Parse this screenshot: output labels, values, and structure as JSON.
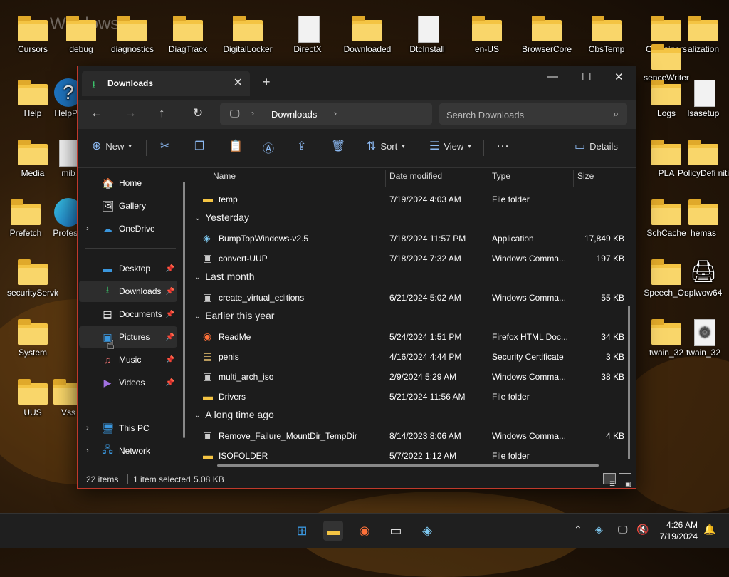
{
  "desktop": {
    "watermark": "Windows",
    "icons": [
      {
        "label": "Cursors",
        "kind": "folder"
      },
      {
        "label": "debug",
        "kind": "folder"
      },
      {
        "label": "diagnostics",
        "kind": "folder"
      },
      {
        "label": "DiagTrack",
        "kind": "folder"
      },
      {
        "label": "DigitalLocker",
        "kind": "folder"
      },
      {
        "label": "DirectX",
        "kind": "file"
      },
      {
        "label": "Downloaded",
        "kind": "folder"
      },
      {
        "label": "DtcInstall",
        "kind": "file"
      },
      {
        "label": "en-US",
        "kind": "folder"
      },
      {
        "label": "BrowserCore",
        "kind": "folder"
      },
      {
        "label": "CbsTemp",
        "kind": "folder"
      },
      {
        "label": "Containers",
        "kind": "folder"
      },
      {
        "label": "alization",
        "kind": "folder"
      },
      {
        "label": "senceWriter",
        "kind": "folder"
      },
      {
        "label": "Help",
        "kind": "folder"
      },
      {
        "label": "HelpPa",
        "kind": "help"
      },
      {
        "label": "Logs",
        "kind": "folder"
      },
      {
        "label": "lsasetup",
        "kind": "file"
      },
      {
        "label": "Media",
        "kind": "folder"
      },
      {
        "label": "mib",
        "kind": "file"
      },
      {
        "label": "PLA",
        "kind": "folder"
      },
      {
        "label": "PolicyDefi nitions",
        "kind": "folder"
      },
      {
        "label": "Prefetch",
        "kind": "folder"
      },
      {
        "label": "Professi",
        "kind": "edge"
      },
      {
        "label": "SchCache",
        "kind": "folder"
      },
      {
        "label": "hemas",
        "kind": "folder"
      },
      {
        "label": "securityService",
        "kind": "folder"
      },
      {
        "label": "Speech_On",
        "kind": "folder"
      },
      {
        "label": "splwow64",
        "kind": "printer"
      },
      {
        "label": "System",
        "kind": "folder"
      },
      {
        "label": "twain_32",
        "kind": "folder"
      },
      {
        "label": "twain_32",
        "kind": "gear"
      },
      {
        "label": "UUS",
        "kind": "folder"
      },
      {
        "label": "Vss",
        "kind": "folder"
      }
    ]
  },
  "window": {
    "tab_title": "Downloads",
    "tab_icon": "download-arrow-icon",
    "address": {
      "crumb": "Downloads"
    },
    "search_placeholder": "Search Downloads",
    "toolbar": {
      "new_label": "New",
      "sort_label": "Sort",
      "view_label": "View",
      "details_label": "Details"
    },
    "nav": {
      "home": "Home",
      "gallery": "Gallery",
      "onedrive": "OneDrive",
      "desktop": "Desktop",
      "downloads": "Downloads",
      "documents": "Documents",
      "pictures": "Pictures",
      "music": "Music",
      "videos": "Videos",
      "thispc": "This PC",
      "network": "Network"
    },
    "columns": {
      "name": "Name",
      "date": "Date modified",
      "type": "Type",
      "size": "Size"
    },
    "groups": {
      "yesterday": "Yesterday",
      "lastmonth": "Last month",
      "earlier": "Earlier this year",
      "longago": "A long time ago"
    },
    "files": [
      {
        "name": "temp",
        "date": "7/19/2024 4:03 AM",
        "type": "File folder",
        "size": ""
      },
      {
        "name": "BumpTopWindows-v2.5",
        "date": "7/18/2024 11:57 PM",
        "type": "Application",
        "size": "17,849 KB"
      },
      {
        "name": "convert-UUP",
        "date": "7/18/2024 7:32 AM",
        "type": "Windows Comma...",
        "size": "197 KB"
      },
      {
        "name": "create_virtual_editions",
        "date": "6/21/2024 5:02 AM",
        "type": "Windows Comma...",
        "size": "55 KB"
      },
      {
        "name": "ReadMe",
        "date": "5/24/2024 1:51 PM",
        "type": "Firefox HTML Doc...",
        "size": "34 KB"
      },
      {
        "name": "penis",
        "date": "4/16/2024 4:44 PM",
        "type": "Security Certificate",
        "size": "3 KB"
      },
      {
        "name": "multi_arch_iso",
        "date": "2/9/2024 5:29 AM",
        "type": "Windows Comma...",
        "size": "38 KB"
      },
      {
        "name": "Drivers",
        "date": "5/21/2024 11:56 AM",
        "type": "File folder",
        "size": ""
      },
      {
        "name": "Remove_Failure_MountDir_TempDir",
        "date": "8/14/2023 8:06 AM",
        "type": "Windows Comma...",
        "size": "4 KB"
      },
      {
        "name": "ISOFOLDER",
        "date": "5/7/2022 1:12 AM",
        "type": "File folder",
        "size": ""
      }
    ],
    "status": {
      "count": "22 items",
      "selected": "1 item selected",
      "size": "5.08 KB"
    }
  },
  "taskbar": {
    "time": "4:26 AM",
    "date": "7/19/2024"
  }
}
